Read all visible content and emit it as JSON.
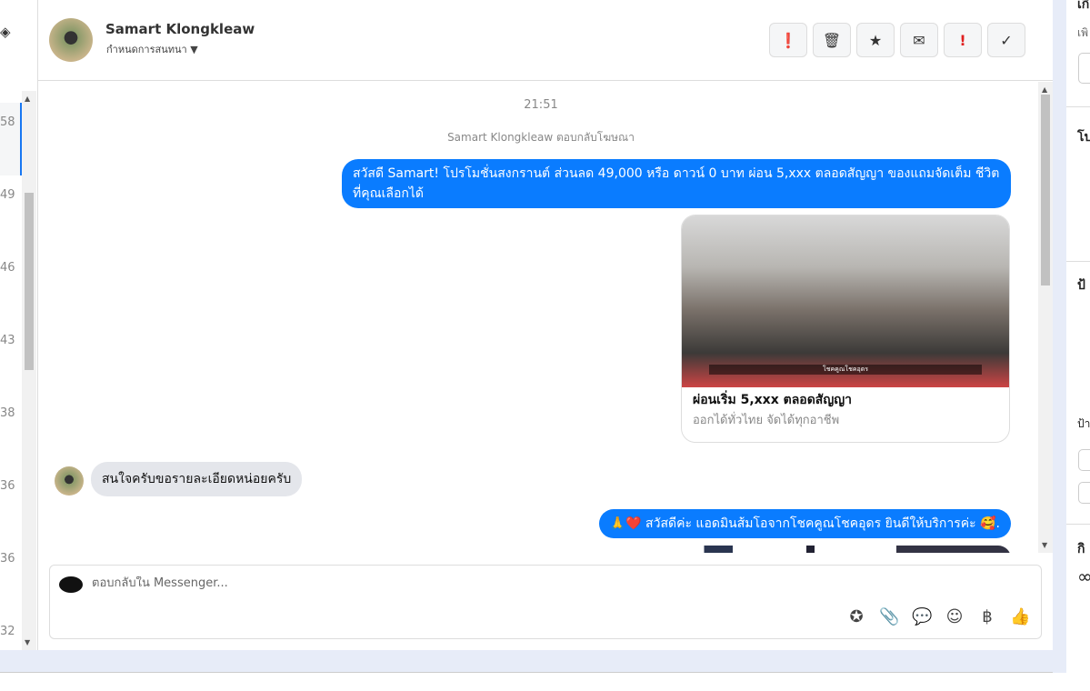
{
  "left_list": {
    "counts": [
      "58",
      "49",
      "46",
      "43",
      "38",
      "36",
      "36",
      "32"
    ]
  },
  "header": {
    "contact_name": "Samart Klongkleaw",
    "assign_label": "กำหนดการสนทนา",
    "actions": [
      {
        "icon": "alert-circle-icon",
        "symbol": "❗"
      },
      {
        "icon": "trash-icon",
        "symbol": "🗑"
      },
      {
        "icon": "star-icon",
        "symbol": "★"
      },
      {
        "icon": "mail-icon",
        "symbol": "✉"
      },
      {
        "icon": "exclamation-icon",
        "symbol": "!"
      },
      {
        "icon": "check-icon",
        "symbol": "✓"
      }
    ]
  },
  "thread": {
    "time": "21:51",
    "ad_reply_note": "Samart Klongkleaw ตอบกลับโฆษณา",
    "msg1": "สวัสดี Samart! โปรโมชั่นสงกรานต์ ส่วนลด 49,000 หรือ ดาวน์ 0 บาท ผ่อน 5,xxx ตลอดสัญญา ของแถมจัดเต็ม ชีวิตที่คุณเลือกได้",
    "card": {
      "title": "ผ่อนเริ่ม 5,xxx ตลอดสัญญา",
      "subtitle": "ออกได้ทั่วไทย จัดได้ทุกอาชีพ",
      "image_caption": "โชคคูณโชคอุดร"
    },
    "msg2": "สนใจครับขอรายละเอียดหน่อยครับ",
    "msg3": "🙏❤️ สวัสดีค่ะ แอดมินส้มโอจากโชคคูณโชคอุดร ยินดีให้บริการค่ะ 🥰."
  },
  "composer": {
    "placeholder": "ตอบกลับใน Messenger...",
    "tools": [
      {
        "icon": "saved-reply-icon",
        "symbol": "✪"
      },
      {
        "icon": "paperclip-icon",
        "symbol": "📎"
      },
      {
        "icon": "chat-dots-icon",
        "symbol": "💬"
      },
      {
        "icon": "emoji-icon",
        "symbol": "☺"
      },
      {
        "icon": "baht-icon",
        "symbol": "฿"
      },
      {
        "icon": "thumbs-up-icon",
        "symbol": "👍"
      }
    ]
  },
  "right_panel": {
    "rows": [
      "เกี",
      "เพิ",
      "โป",
      "ป้",
      "ป้า",
      "กิ",
      "∞"
    ]
  }
}
